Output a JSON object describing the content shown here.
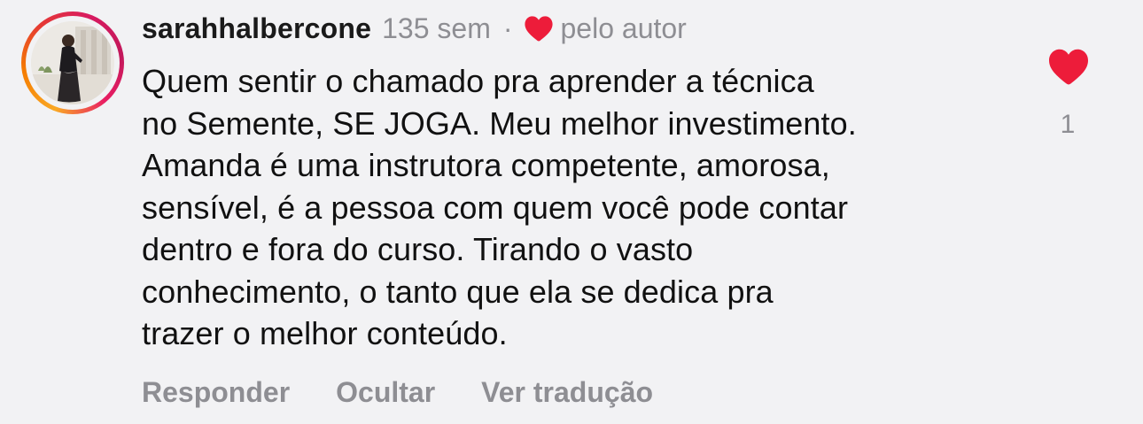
{
  "comment": {
    "author": {
      "username": "sarahhalbercone",
      "avatar_icon": "profile-photo",
      "story_ring_colors": [
        "#f9a825",
        "#e53935",
        "#d81b60"
      ]
    },
    "timestamp": "135 sem",
    "separator": "·",
    "liked_by_author_icon": "heart-icon",
    "liked_by_author_label": "pelo autor",
    "text_lines": [
      "Quem sentir o chamado pra aprender a técnica",
      "no Semente, SE JOGA. Meu melhor investimento.",
      "Amanda é uma instrutora competente, amorosa,",
      "sensível, é a pessoa com quem você pode contar",
      "dentro e fora do curso. Tirando o vasto",
      "conhecimento, o tanto que ela se dedica pra",
      "trazer o melhor conteúdo."
    ],
    "like": {
      "icon": "heart-icon",
      "liked": true,
      "count": "1",
      "color": "#ed4956"
    },
    "actions": {
      "reply": "Responder",
      "hide": "Ocultar",
      "translate": "Ver tradução"
    }
  }
}
